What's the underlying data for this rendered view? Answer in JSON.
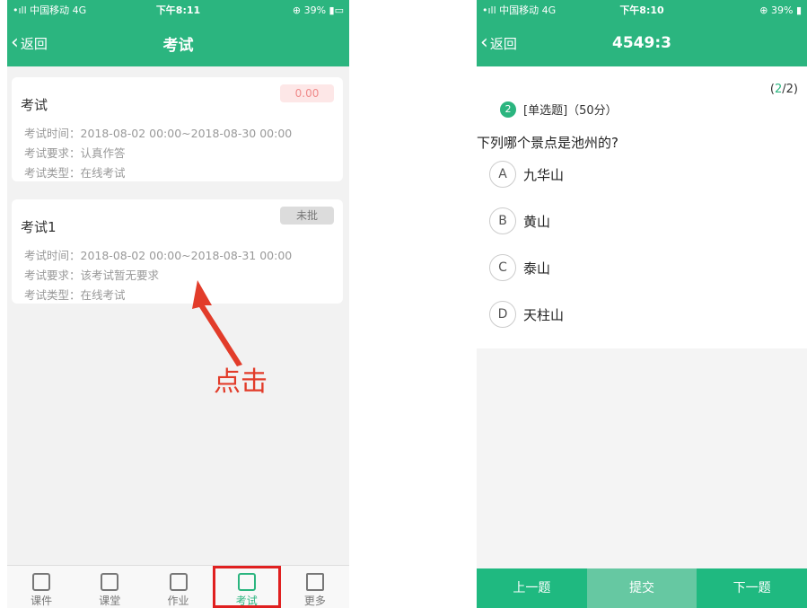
{
  "left": {
    "status": {
      "carrier": "•ıll 中国移动  4G",
      "time": "下午8:11",
      "battery": "⊕ 39% ▮▭"
    },
    "nav": {
      "back": "返回",
      "title": "考试"
    },
    "cards": [
      {
        "title": "考试",
        "badge": "0.00",
        "time": "考试时间：2018-08-02 00:00~2018-08-30 00:00",
        "req": "考试要求：认真作答",
        "type": "考试类型：在线考试"
      },
      {
        "title": "考试1",
        "badge": "未批",
        "time": "考试时间：2018-08-02 00:00~2018-08-31 00:00",
        "req": "考试要求：该考试暂无要求",
        "type": "考试类型：在线考试"
      }
    ],
    "annotation": "点击",
    "tabs": [
      "课件",
      "课堂",
      "作业",
      "考试",
      "更多"
    ],
    "colors": {
      "accent": "#2bb57f",
      "annotation": "#e23c2a"
    }
  },
  "right": {
    "status": {
      "carrier": "•ıll 中国移动  4G",
      "time": "下午8:10",
      "battery": "⊕ 39% ▮"
    },
    "nav": {
      "back": "返回",
      "title": "4549:3"
    },
    "progress_open": "(",
    "progress_current": "2",
    "progress_rest": "/2)",
    "question": {
      "number": "2",
      "type": "[单选题]（50分）",
      "text": "下列哪个景点是池州的?"
    },
    "options": [
      {
        "letter": "A",
        "text": "九华山"
      },
      {
        "letter": "B",
        "text": "黄山"
      },
      {
        "letter": "C",
        "text": "泰山"
      },
      {
        "letter": "D",
        "text": "天柱山"
      }
    ],
    "buttons": {
      "prev": "上一题",
      "submit": "提交",
      "next": "下一题"
    }
  }
}
